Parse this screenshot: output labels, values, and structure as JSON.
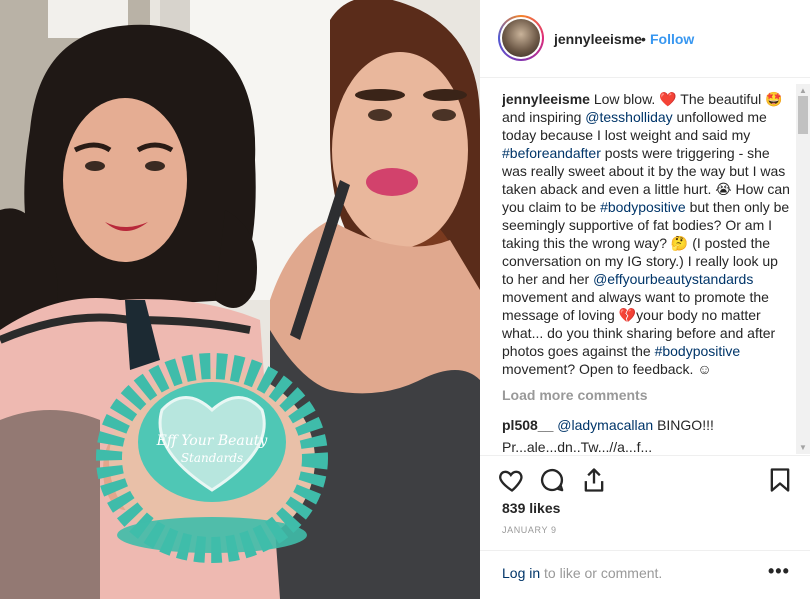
{
  "post": {
    "username": "jennyleeisme",
    "separator": "•",
    "follow_label": "Follow"
  },
  "caption": {
    "username": "jennyleeisme",
    "t1": " Low blow. ",
    "emoji1": "❤️",
    "t2": " The beautiful ",
    "emoji2": "🤩",
    "t3": " and inspiring ",
    "mention1": "@tessholliday",
    "t4": " unfollowed me today because I lost weight and said my ",
    "hashtag1": "#beforeandafter",
    "t5": " posts were triggering - she was really sweet about it by the way but I was taken aback and even a little hurt. ",
    "emoji3": "😭",
    "t6": " How can you claim to be ",
    "hashtag2": "#bodypositive",
    "t7": " but then only be seemingly supportive of fat bodies? Or am I taking this the wrong way? ",
    "emoji4": "🤔",
    "t8": " (I posted the conversation on my IG story.) I really look up to her and her ",
    "mention2": "@effyourbeautystandards",
    "t9": " movement and always want to promote the message of loving ",
    "emoji5": "💔",
    "t10": "your body no matter what... do you think sharing before and after photos goes against the ",
    "hashtag3": "#bodypositive",
    "t11": " movement? Open to feedback. ",
    "emoji6": "☺"
  },
  "load_more_label": "Load more comments",
  "comment": {
    "username": "pl508__",
    "mention": "@ladymacallan",
    "text": " BINGO!!!",
    "cut_text": "Pr...ale...dn..Tw...//a...f..."
  },
  "icons": {
    "like": "heart-icon",
    "comment": "comment-icon",
    "share": "share-icon",
    "save": "bookmark-icon",
    "more": "more-icon"
  },
  "likes_label": "839 likes",
  "date_label": "JANUARY 9",
  "footer": {
    "login_link": "Log in",
    "login_text": " to like or comment.",
    "more_label": "•••"
  },
  "colors": {
    "link": "#003569",
    "follow": "#3897f0",
    "muted": "#999999",
    "border": "#efefef"
  }
}
